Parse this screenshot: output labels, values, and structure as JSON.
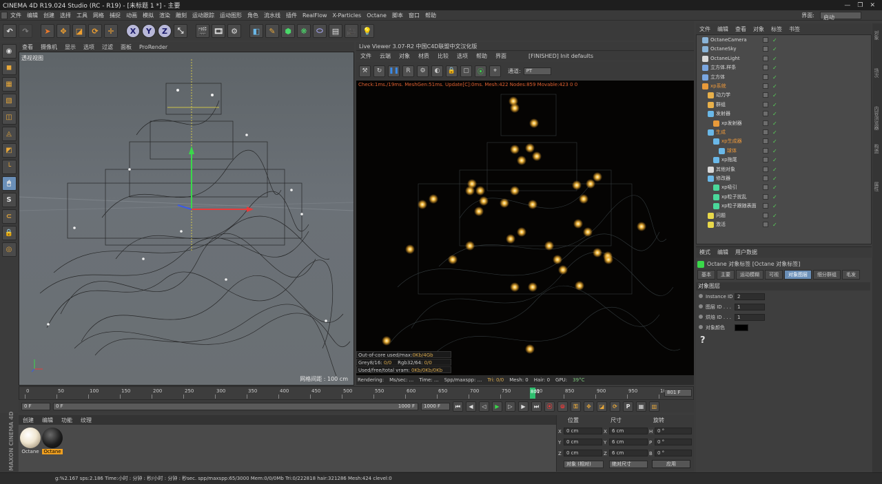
{
  "window": {
    "title": "CINEMA 4D R19.024 Studio (RC - R19) - [未标题 1 *] - 主要",
    "layout_label": "界面:",
    "layout_value": "启动"
  },
  "menu": [
    "文件",
    "编辑",
    "创建",
    "选择",
    "工具",
    "网格",
    "捕捉",
    "动画",
    "模拟",
    "渲染",
    "雕刻",
    "运动跟踪",
    "运动图形",
    "角色",
    "流水线",
    "插件",
    "RealFlow",
    "X-Particles",
    "Octane",
    "脚本",
    "窗口",
    "帮助"
  ],
  "viewport": {
    "menu": [
      "查看",
      "摄像机",
      "显示",
      "选项",
      "过滤",
      "面板",
      "ProRender"
    ],
    "label": "透视视图",
    "grid_label": "网格间距 : 100 cm"
  },
  "live_viewer": {
    "title": "Live Viewer 3.07-R2 中国C4D联盟中文汉化版",
    "menu": [
      "文件",
      "云端",
      "对象",
      "材质",
      "比较",
      "选项",
      "帮助",
      "界面"
    ],
    "status_msg": "[FINISHED] Init defaults",
    "channel_label": "通道:",
    "channel_value": "PT",
    "stat_line": "Check:1ms./19ms. MeshGen:51ms. Update[C]:0ms. Mesh:422 Nodes:859 Movable:423  0 0",
    "info": [
      {
        "label": "Out-of-core used/max:",
        "value": "0Kb/4Gb"
      },
      {
        "label": "Grey8/16: ",
        "value": "0/0",
        "label2": "Rgb32/64: ",
        "value2": "0/0"
      },
      {
        "label": "Used/free/total vram: ",
        "value": "0Kb/0Kb/0Kb"
      }
    ],
    "bottom": {
      "rendering": "Rendering:",
      "mssec": "Ms/sec: ...",
      "time": "Time: ...",
      "spp": "Spp/maxspp: ...",
      "tri": "Tri: 0/0",
      "mesh": "Mesh: 0",
      "hair": "Hair: 0",
      "gpu": "GPU:",
      "temp": "39°C"
    }
  },
  "timeline": {
    "ticks": [
      "0",
      "50",
      "100",
      "150",
      "200",
      "250",
      "300",
      "350",
      "400",
      "450",
      "500",
      "550",
      "600",
      "650",
      "700",
      "750",
      "800",
      "850",
      "900",
      "950",
      "1000"
    ],
    "current": "801",
    "end_field": "801 F"
  },
  "timebar": {
    "start": "0 F",
    "range_start": "0 F",
    "range_end": "1000 F",
    "end": "1000 F"
  },
  "material_manager": {
    "menu": [
      "创建",
      "编辑",
      "功能",
      "纹理"
    ],
    "materials": [
      {
        "name": "Octane",
        "color": "#f0e6d0"
      },
      {
        "name": "Octane",
        "color": "#1e1e1e"
      }
    ]
  },
  "coords": {
    "headers": [
      "位置",
      "尺寸",
      "旋转"
    ],
    "rows": [
      {
        "axis": "X",
        "pos": "0 cm",
        "size_axis": "X",
        "size": "6 cm",
        "rot_axis": "H",
        "rot": "0 °"
      },
      {
        "axis": "Y",
        "pos": "0 cm",
        "size_axis": "Y",
        "size": "6 cm",
        "rot_axis": "P",
        "rot": "0 °"
      },
      {
        "axis": "Z",
        "pos": "0 cm",
        "size_axis": "Z",
        "size": "6 cm",
        "rot_axis": "B",
        "rot": "0 °"
      }
    ],
    "mode1": "对象 (相对)",
    "mode2": "绝对尺寸",
    "apply": "应用"
  },
  "status_bar": "g:%2.167 sps:2.186 Time:小时 : 分钟 : 秒/小时 : 分钟 : 秒sec. spp/maxspp:65/3000 Mem:0/0/0Mb Tri:0/222818 hair:321286 Mesh:424 clevel:0",
  "object_manager": {
    "menu": [
      "文件",
      "编辑",
      "查看",
      "对象",
      "标签",
      "书签"
    ],
    "objects": [
      {
        "name": "OctaneCamera",
        "indent": 0,
        "color": "#8ab4d8",
        "orange": false
      },
      {
        "name": "OctaneSky",
        "indent": 0,
        "color": "#8ab4d8",
        "orange": false
      },
      {
        "name": "OctaneLight",
        "indent": 0,
        "color": "#d8d8d8",
        "orange": false
      },
      {
        "name": "立方体.样条",
        "indent": 0,
        "color": "#7aa6e0",
        "orange": false
      },
      {
        "name": "立方体",
        "indent": 0,
        "color": "#7aa6e0",
        "orange": false
      },
      {
        "name": "xp系统",
        "indent": 0,
        "color": "#e89a3a",
        "orange": true
      },
      {
        "name": "动力学",
        "indent": 1,
        "color": "#e8b04a",
        "orange": false
      },
      {
        "name": "群组",
        "indent": 1,
        "color": "#e8b04a",
        "orange": false
      },
      {
        "name": "发射器",
        "indent": 1,
        "color": "#6ab8e8",
        "orange": false
      },
      {
        "name": "xp发射器",
        "indent": 2,
        "color": "#e89a3a",
        "orange": false
      },
      {
        "name": "生成",
        "indent": 1,
        "color": "#6ab8e8",
        "orange": true
      },
      {
        "name": "xp生成器",
        "indent": 2,
        "color": "#6ab8e8",
        "orange": true
      },
      {
        "name": "球体",
        "indent": 3,
        "color": "#6ab8e8",
        "orange": true
      },
      {
        "name": "xp拖尾",
        "indent": 2,
        "color": "#6ab8e8",
        "orange": false
      },
      {
        "name": "其他对象",
        "indent": 1,
        "color": "#d8d8d8",
        "orange": false
      },
      {
        "name": "修改器",
        "indent": 1,
        "color": "#6ab8e8",
        "orange": false
      },
      {
        "name": "xp吸引",
        "indent": 2,
        "color": "#4ad89a",
        "orange": false
      },
      {
        "name": "xp粒子扰乱",
        "indent": 2,
        "color": "#4ad89a",
        "orange": false
      },
      {
        "name": "xp粒子跟随表面",
        "indent": 2,
        "color": "#4ad89a",
        "orange": false
      },
      {
        "name": "问题",
        "indent": 1,
        "color": "#e8d84a",
        "orange": false
      },
      {
        "name": "激活",
        "indent": 1,
        "color": "#e8d84a",
        "orange": false
      }
    ]
  },
  "attribute_manager": {
    "menu": [
      "模式",
      "编辑",
      "用户数据"
    ],
    "title": "Octane 对象标签 [Octane 对象标签]",
    "tabs": [
      "基本",
      "主要",
      "运动模糊",
      "可视",
      "对象图层",
      "细分群组",
      "毛发"
    ],
    "active_tab": "对象图层",
    "section": "对象图层",
    "props": [
      {
        "label": "Instance ID",
        "value": "2"
      },
      {
        "label": "图层 ID . . .",
        "value": "1"
      },
      {
        "label": "烘焙 ID . . .",
        "value": "1"
      },
      {
        "label": "对象颜色",
        "value": ""
      }
    ]
  },
  "right_side_tabs": [
    "对象",
    "场次",
    "内容浏览器",
    "构造",
    "属性"
  ]
}
